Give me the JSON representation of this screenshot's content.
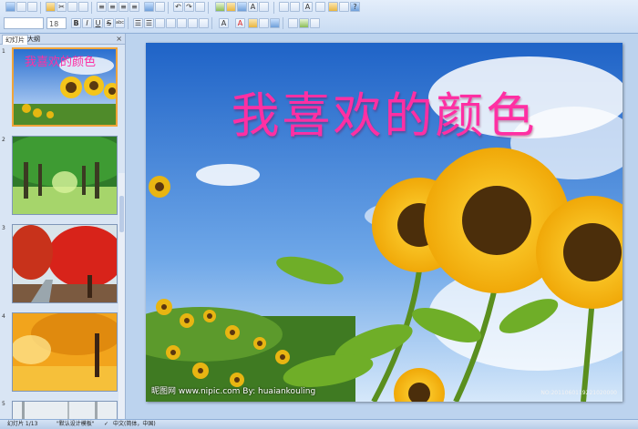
{
  "toolbar": {
    "font_name": "",
    "font_size": "18",
    "bold": "B",
    "italic": "I",
    "underline": "U",
    "strike": "S",
    "shadow": "abc",
    "font_color": "A"
  },
  "panel": {
    "tab_slides": "幻灯片",
    "tab_outline": "大纲",
    "close": "×",
    "slide_numbers": [
      "1",
      "2",
      "3",
      "4",
      "5"
    ],
    "thumb1_title": "我喜欢的颜色"
  },
  "slide": {
    "title": "我喜欢的颜色",
    "watermark_text": "昵图网 www.nipic.com   By: huaiankouling",
    "corner_text": "NO:2011060119221020000"
  },
  "status": {
    "slide_count": "幻灯片 1/13",
    "theme": "\"默认设计模板\"",
    "language": "中文(简体，中国)"
  },
  "colors": {
    "title_pink": "#ff2fa3",
    "ribbon": "#dbe8f8",
    "selected_border": "#f1a53a"
  }
}
